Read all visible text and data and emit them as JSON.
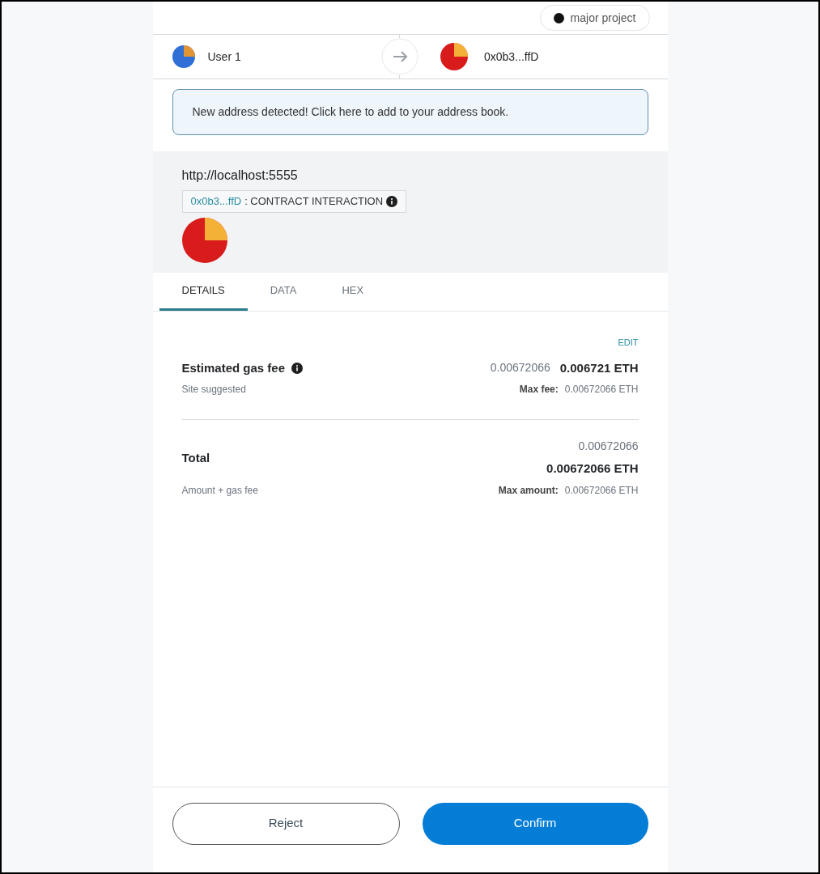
{
  "network": {
    "name": "major project"
  },
  "sender": {
    "name": "User 1"
  },
  "recipient": {
    "name": "0x0b3...ffD"
  },
  "alert": {
    "text": "New address detected! Click here to add to your address book."
  },
  "site": {
    "origin": "http://localhost:5555",
    "address": "0x0b3...ffD",
    "action": ": CONTRACT INTERACTION"
  },
  "tabs": [
    {
      "label": "DETAILS",
      "selected": true
    },
    {
      "label": "DATA",
      "selected": false
    },
    {
      "label": "HEX",
      "selected": false
    }
  ],
  "edit": "EDIT",
  "gas": {
    "label": "Estimated gas fee",
    "sublabel": "Site suggested",
    "secondary": "0.00672066",
    "primary": "0.006721 ETH",
    "max_label": "Max fee:",
    "max_value": "0.00672066 ETH"
  },
  "total": {
    "label": "Total",
    "sublabel": "Amount + gas fee",
    "secondary": "0.00672066",
    "primary": "0.00672066 ETH",
    "max_label": "Max amount:",
    "max_value": "0.00672066 ETH"
  },
  "buttons": {
    "reject": "Reject",
    "confirm": "Confirm"
  }
}
